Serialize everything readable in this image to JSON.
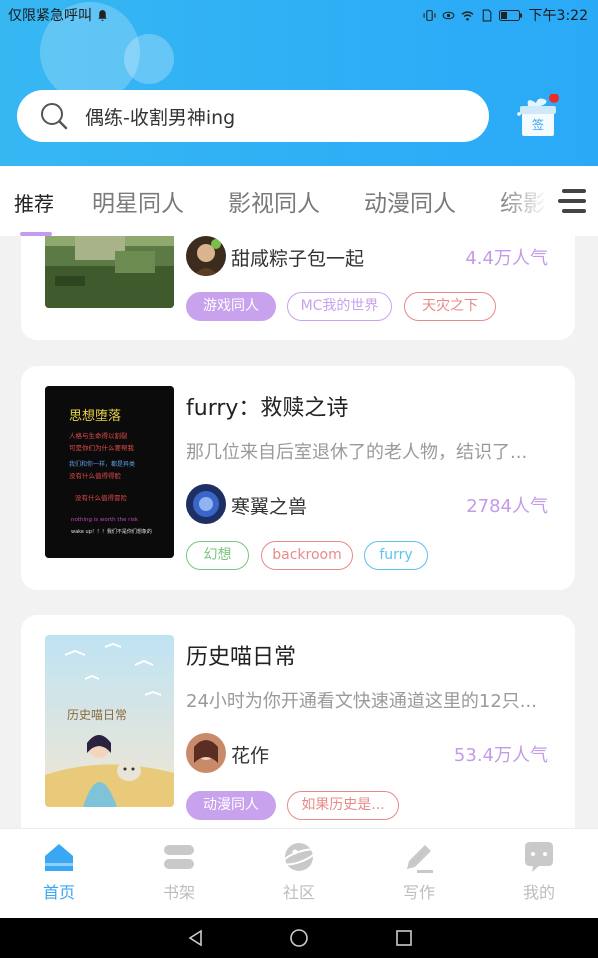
{
  "statusbar": {
    "carrier": "仅限紧急呼叫",
    "time": "下午3:22"
  },
  "search": {
    "placeholder": "偶练-收割男神ing"
  },
  "gift": {
    "label": "签"
  },
  "tabs": [
    {
      "label": "推荐",
      "active": true
    },
    {
      "label": "明星同人"
    },
    {
      "label": "影视同人"
    },
    {
      "label": "动漫同人"
    },
    {
      "label": "综影"
    }
  ],
  "cards": [
    {
      "title": "",
      "author": "甜咸粽子包一起",
      "popularity": "4.4万人气",
      "tags": [
        {
          "label": "游戏同人",
          "style": "filled-purple"
        },
        {
          "label": "MC我的世界",
          "style": "outline-purple"
        },
        {
          "label": "天灾之下",
          "style": "outline-red"
        }
      ]
    },
    {
      "title": "furry：救赎之诗",
      "description": "那几位来自后室退休了的老人物，结识了...",
      "author": "寒翼之兽",
      "popularity": "2784人气",
      "cover_text": {
        "heading": "思想堕落",
        "lines": [
          "人格与生命得以割裂",
          "可是你们为什么要帮我",
          "我们和你一样，都是异类",
          "没有什么值得得脸",
          "没有什么值得冒险",
          "nothing is worth the risk",
          "wake up！！！我们不是你们想象的"
        ]
      },
      "tags": [
        {
          "label": "幻想",
          "style": "outline-green"
        },
        {
          "label": "backroom",
          "style": "outline-red"
        },
        {
          "label": "furry",
          "style": "outline-blue"
        }
      ]
    },
    {
      "title": "历史喵日常",
      "description": "24小时为你开通看文快速通道这里的12只...",
      "author": "花作",
      "popularity": "53.4万人气",
      "cover_text": {
        "heading": "历史喵日常"
      },
      "tags": [
        {
          "label": "动漫同人",
          "style": "filled-purple"
        },
        {
          "label": "如果历史是...",
          "style": "outline-red"
        }
      ]
    }
  ],
  "bottomnav": [
    {
      "label": "首页",
      "icon": "home-icon",
      "active": true
    },
    {
      "label": "书架",
      "icon": "bookshelf-icon"
    },
    {
      "label": "社区",
      "icon": "community-icon"
    },
    {
      "label": "写作",
      "icon": "pen-icon"
    },
    {
      "label": "我的",
      "icon": "profile-icon"
    }
  ],
  "colors": {
    "header_blue": "#30b1f4",
    "accent_purple": "#c39be8",
    "tag_red": "#e88a8a",
    "tag_green": "#7bc67e",
    "tag_blue": "#5fc3ec",
    "nav_active": "#3aa7f3"
  }
}
